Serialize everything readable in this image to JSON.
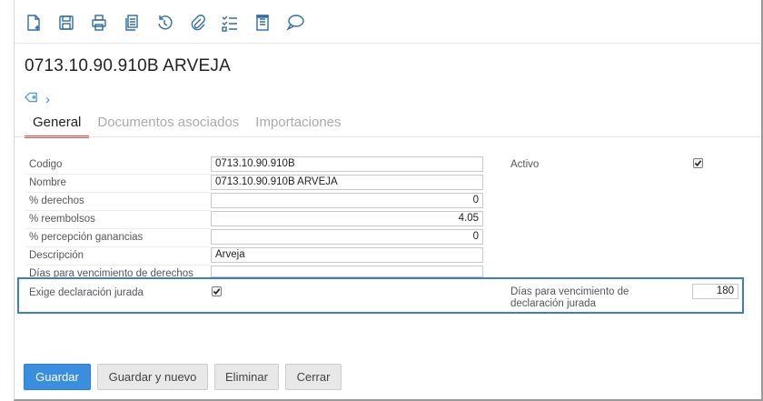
{
  "toolbar": {
    "icons": [
      "new-document-icon",
      "save-icon",
      "print-icon",
      "copy-icon",
      "history-icon",
      "attachment-icon",
      "checklist-icon",
      "notes-icon",
      "comment-icon"
    ]
  },
  "record": {
    "title": "0713.10.90.910B ARVEJA",
    "breadcrumb_arrow": "›"
  },
  "tabs": [
    {
      "label": "General",
      "active": true
    },
    {
      "label": "Documentos asociados",
      "active": false
    },
    {
      "label": "Importaciones",
      "active": false
    }
  ],
  "form": {
    "codigo": {
      "label": "Codigo",
      "value": "0713.10.90.910B"
    },
    "nombre": {
      "label": "Nombre",
      "value": "0713.10.90.910B ARVEJA"
    },
    "derechos": {
      "label": "% derechos",
      "value": "0"
    },
    "reembolsos": {
      "label": "% reembolsos",
      "value": "4.05"
    },
    "percepcion": {
      "label": "% percepción ganancias",
      "value": "0"
    },
    "descripcion": {
      "label": "Descripción",
      "value": "Arveja"
    },
    "dias_venc_derechos": {
      "label": "Días para vencimiento de derechos",
      "value": ""
    },
    "activo": {
      "label": "Activo",
      "checked": true
    },
    "exige_declaracion": {
      "label": "Exige declaración jurada",
      "checked": true
    },
    "dias_venc_declaracion": {
      "label_line1": "Días para vencimiento de",
      "label_line2": "declaración jurada",
      "value": "180"
    }
  },
  "buttons": {
    "guardar": "Guardar",
    "guardar_nuevo": "Guardar y nuevo",
    "eliminar": "Eliminar",
    "cerrar": "Cerrar"
  },
  "colors": {
    "accent": "#3a8ee0",
    "tab_underline": "#d9534f",
    "highlight": "#3b7dcc"
  }
}
